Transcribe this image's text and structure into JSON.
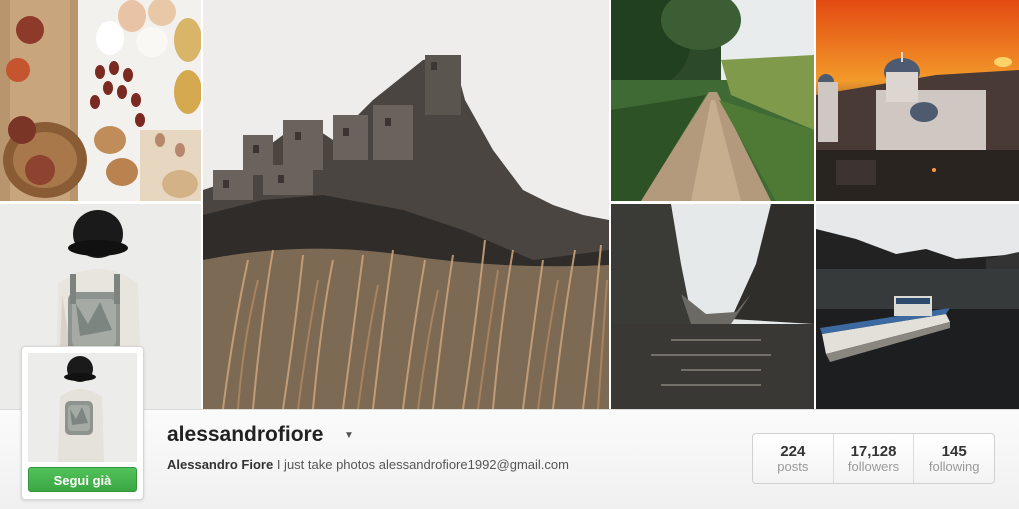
{
  "profile": {
    "username": "alessandrofiore",
    "full_name": "Alessandro Fiore",
    "bio": "I just take photos alessandrofiore1992@gmail.com",
    "follow_button": "Segui già"
  },
  "stats": [
    {
      "value": "224",
      "label": "posts"
    },
    {
      "value": "17,128",
      "label": "followers"
    },
    {
      "value": "145",
      "label": "following"
    }
  ],
  "icons": {
    "dropdown": "caret-down-icon"
  },
  "colors": {
    "follow_green": "#3ba743",
    "text_dark": "#222222",
    "text_muted": "#999999"
  }
}
